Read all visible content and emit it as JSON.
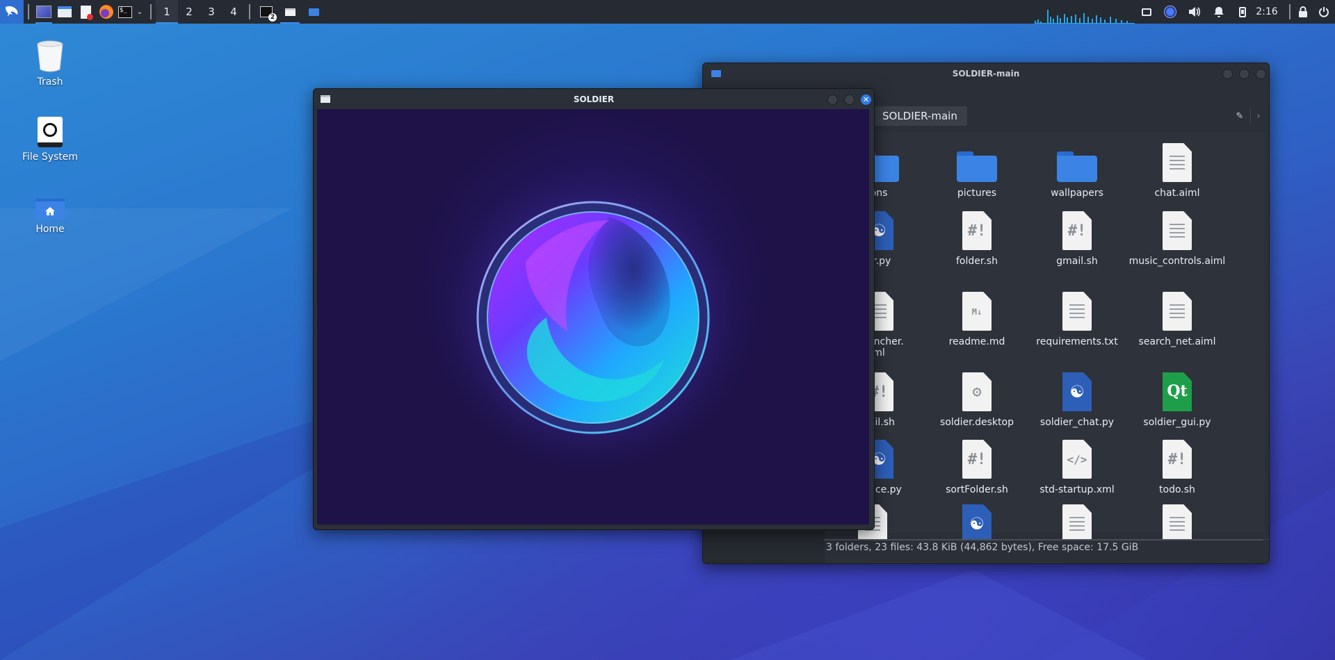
{
  "taskbar": {
    "apps": [
      "kali-menu-icon",
      "desktop-icon",
      "files-icon",
      "text-editor-icon",
      "firefox-icon",
      "terminal-icon"
    ],
    "workspaces": [
      "1",
      "2",
      "3",
      "4"
    ],
    "active_workspace": "1",
    "terminal_badge": "2",
    "clock": "2:16"
  },
  "desktop": {
    "icons": [
      {
        "label": "Trash"
      },
      {
        "label": "File System"
      },
      {
        "label": "Home"
      }
    ]
  },
  "file_manager": {
    "title": "SOLDIER-main",
    "path": "SOLDIER-main",
    "items": [
      {
        "name": "ons",
        "kind": "folder"
      },
      {
        "name": "pictures",
        "kind": "folder"
      },
      {
        "name": "wallpapers",
        "kind": "folder"
      },
      {
        "name": "chat.aiml",
        "kind": "text"
      },
      {
        "name": "er.py",
        "kind": "python"
      },
      {
        "name": "folder.sh",
        "kind": "shell"
      },
      {
        "name": "gmail.sh",
        "kind": "shell"
      },
      {
        "name": "music_controls.aiml",
        "kind": "text"
      },
      {
        "name": "_launcher.",
        "name2": "ml",
        "kind": "text"
      },
      {
        "name": "readme.md",
        "kind": "markdown"
      },
      {
        "name": "requirements.txt",
        "kind": "text"
      },
      {
        "name": "search_net.aiml",
        "kind": "text"
      },
      {
        "name": "nail.sh",
        "kind": "shell"
      },
      {
        "name": "soldier.desktop",
        "kind": "desktop"
      },
      {
        "name": "soldier_chat.py",
        "kind": "python"
      },
      {
        "name": "soldier_gui.py",
        "kind": "qt"
      },
      {
        "name": "_voice.py",
        "kind": "python"
      },
      {
        "name": "sortFolder.sh",
        "kind": "shell"
      },
      {
        "name": "std-startup.xml",
        "kind": "xml"
      },
      {
        "name": "todo.sh",
        "kind": "shell"
      }
    ],
    "status": "3 folders, 23 files: 43.8 KiB (44,862 bytes), Free space: 17.5 GiB"
  },
  "soldier_window": {
    "title": "SOLDIER"
  },
  "colors": {
    "accent": "#3d8be8",
    "panel": "#262a33",
    "window_bg": "#2b2f37",
    "canvas_bg": "#1e1248"
  }
}
